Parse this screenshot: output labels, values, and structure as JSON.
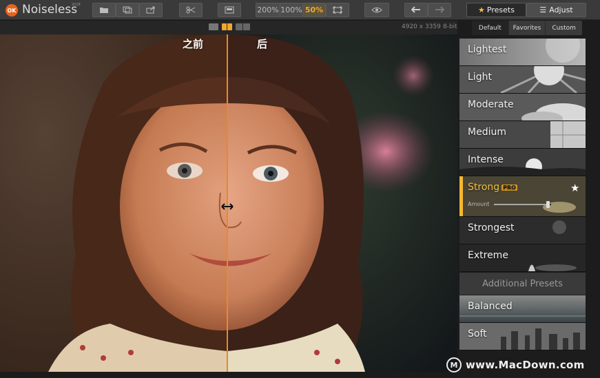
{
  "app": {
    "badge": "OK",
    "title": "Noiseless",
    "year": "2018"
  },
  "toolbar": {
    "zoom_200": "200%",
    "zoom_100": "100%",
    "zoom_50": "50%",
    "presets_label": "Presets",
    "adjust_label": "Adjust"
  },
  "image_info": {
    "dimensions": "4920 x 3359",
    "bit_depth": "8-bit"
  },
  "compare": {
    "before": "之前",
    "after": "后"
  },
  "panel": {
    "tabs": [
      "Default",
      "Favorites",
      "Custom"
    ],
    "presets": [
      {
        "label": "Lightest"
      },
      {
        "label": "Light"
      },
      {
        "label": "Moderate"
      },
      {
        "label": "Medium"
      },
      {
        "label": "Intense"
      },
      {
        "label": "Strong",
        "badge": "PRO",
        "amount_label": "Amount",
        "amount_fraction": 0.95
      },
      {
        "label": "Strongest"
      },
      {
        "label": "Extreme"
      }
    ],
    "additional_header": "Additional Presets",
    "additional": [
      {
        "label": "Balanced"
      },
      {
        "label": "Soft"
      }
    ]
  },
  "watermark": {
    "mark": "M",
    "text": "www.MacDown.com"
  },
  "colors": {
    "accent": "#f0a830",
    "split_line": "#e8892a",
    "selected_strip": "#f5b82e"
  }
}
